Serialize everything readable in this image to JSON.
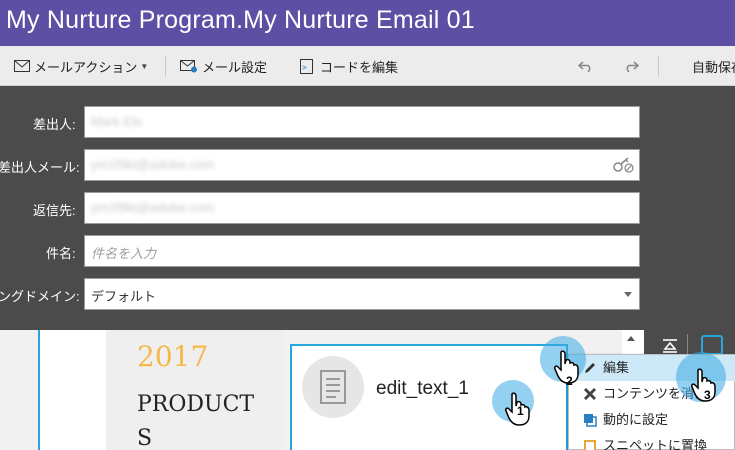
{
  "window": {
    "title": "My Nurture Program.My Nurture Email 01"
  },
  "toolbar": {
    "mail_action_label": "メールアクション",
    "mail_settings_label": "メール設定",
    "edit_code_label": "コードを編集",
    "autosave_label": "自動保存"
  },
  "form": {
    "sender": {
      "label": "差出人:",
      "value": "Mark Elo"
    },
    "sender_email": {
      "label": "差出人メール:",
      "value": "ym1f9kt@adobe.com"
    },
    "reply_to": {
      "label": "返信先:",
      "value": "ym1f9kt@adobe.com"
    },
    "subject": {
      "label": "件名:",
      "placeholder": "件名を入力"
    },
    "domain": {
      "label": "ングドメイン:",
      "value": "デフォルト"
    }
  },
  "canvas": {
    "year_text": "2017",
    "product_text": "PRODUCTS",
    "edit_element_label": "edit_text_1"
  },
  "context_menu": {
    "items": [
      {
        "label": "編集",
        "icon": "pencil-icon",
        "highlighted": true
      },
      {
        "label": "コンテンツを消去",
        "icon": "x-icon",
        "highlighted": false
      },
      {
        "label": "動的に設定",
        "icon": "dynamic-icon",
        "highlighted": false
      },
      {
        "label": "スニペットに置換",
        "icon": "snippet-icon",
        "highlighted": false
      }
    ]
  },
  "callouts": {
    "step1": "1",
    "step2": "2",
    "step3": "3"
  },
  "colors": {
    "titlebar": "#5c4fa4",
    "form_bg": "#4b4b4b",
    "accent": "#27a6dd",
    "year": "#f7b84b"
  }
}
